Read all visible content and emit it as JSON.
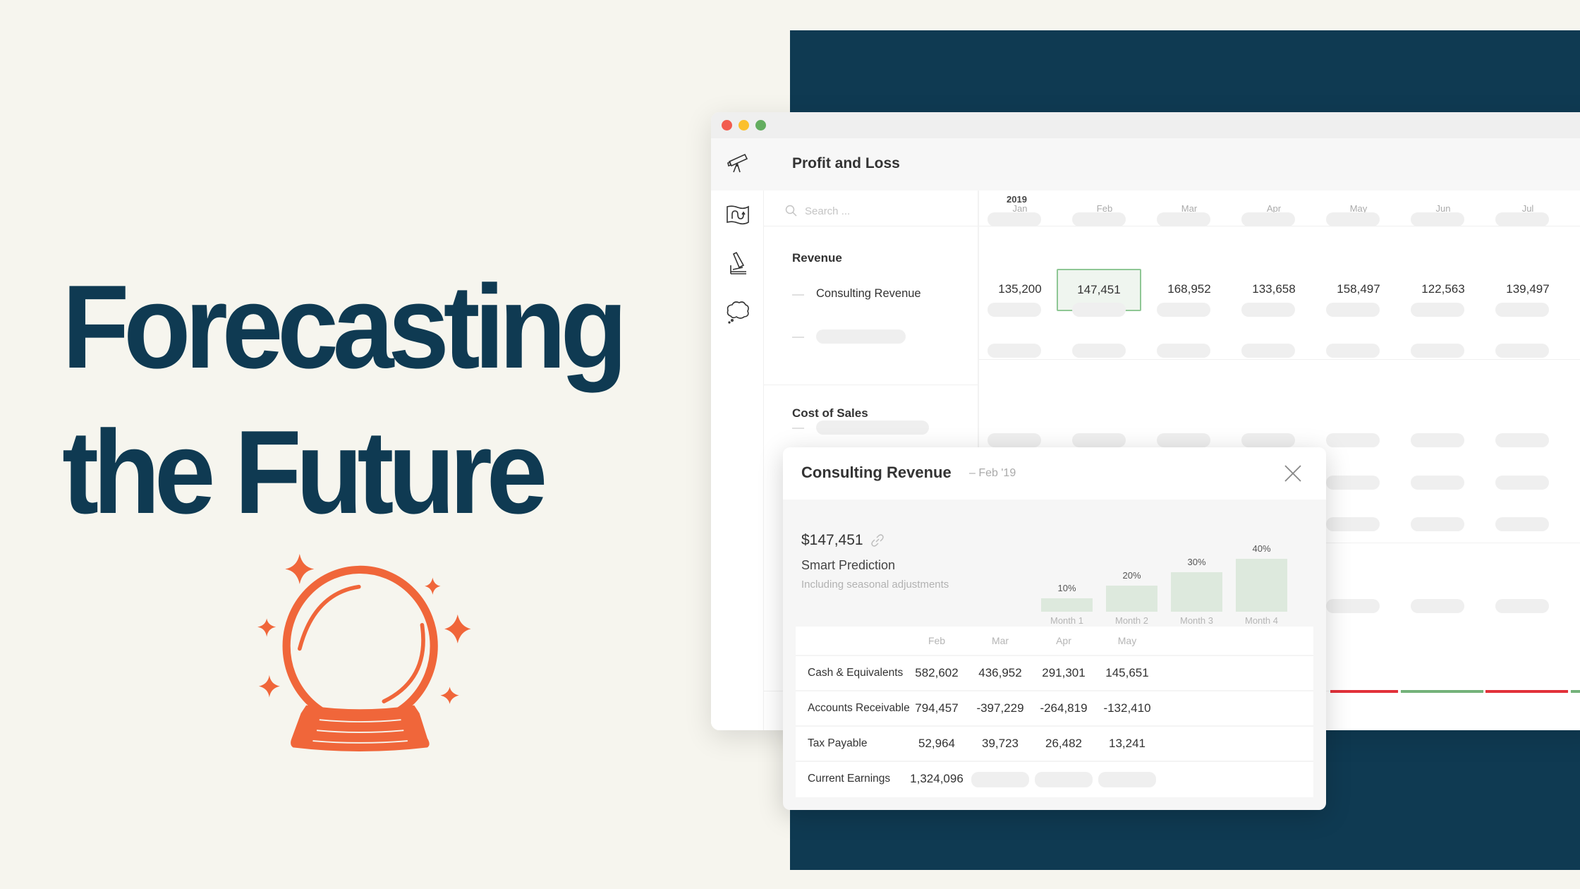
{
  "headline": {
    "line1": "Forecasting",
    "line2": "the Future"
  },
  "illustration": {
    "icon": "crystal-ball-with-sparkles-icon",
    "color": "#f0663a"
  },
  "colors": {
    "navy": "#0f3a52",
    "background": "#f6f5ee",
    "accent_orange": "#f0663a",
    "positive": "#74b27a",
    "negative": "#e2313a",
    "highlight_border": "#8fc795"
  },
  "window": {
    "traffic_lights": [
      "#f25c4f",
      "#fbc02d",
      "#63ad5f"
    ],
    "sidebar_icons": [
      "telescope-icon",
      "map-route-icon",
      "microscope-icon",
      "thought-cloud-icon"
    ],
    "header_title": "Profit and Loss",
    "search_placeholder": "Search ...",
    "year": "2019",
    "months": [
      "Jan",
      "Feb",
      "Mar",
      "Apr",
      "May",
      "Jun",
      "Jul"
    ],
    "sections": [
      {
        "label": "Revenue",
        "rows": [
          {
            "label": "Consulting Revenue",
            "values": [
              "135,200",
              "147,451",
              "168,952",
              "133,658",
              "158,497",
              "122,563",
              "139,497"
            ],
            "selected_index": 1
          },
          {
            "label": "",
            "placeholder": true
          }
        ]
      },
      {
        "label": "Cost of Sales",
        "rows": [
          {
            "label": "",
            "placeholder": true
          }
        ]
      }
    ]
  },
  "popup": {
    "title": "Consulting Revenue",
    "subtitle": "– Feb '19",
    "amount": "$147,451",
    "prediction_label": "Smart Prediction",
    "prediction_sub": "Including seasonal adjustments",
    "close_icon": "close-icon",
    "link_icon": "link-icon",
    "chart_data": {
      "type": "bar",
      "categories": [
        "Month 1",
        "Month 2",
        "Month 3",
        "Month 4"
      ],
      "values": [
        10,
        20,
        30,
        40
      ],
      "labels": [
        "10%",
        "20%",
        "30%",
        "40%"
      ],
      "ylim": [
        0,
        40
      ]
    },
    "table": {
      "columns": [
        "Feb",
        "Mar",
        "Apr",
        "May"
      ],
      "rows": [
        {
          "label": "Cash & Equivalents",
          "values": [
            "582,602",
            "436,952",
            "291,301",
            "145,651"
          ]
        },
        {
          "label": "Accounts Receivable",
          "values": [
            "794,457",
            "-397,229",
            "-264,819",
            "-132,410"
          ]
        },
        {
          "label": "Tax Payable",
          "values": [
            "52,964",
            "39,723",
            "26,482",
            "13,241"
          ]
        },
        {
          "label": "Current Earnings",
          "values": [
            "1,324,096",
            null,
            null,
            null
          ]
        }
      ]
    }
  }
}
